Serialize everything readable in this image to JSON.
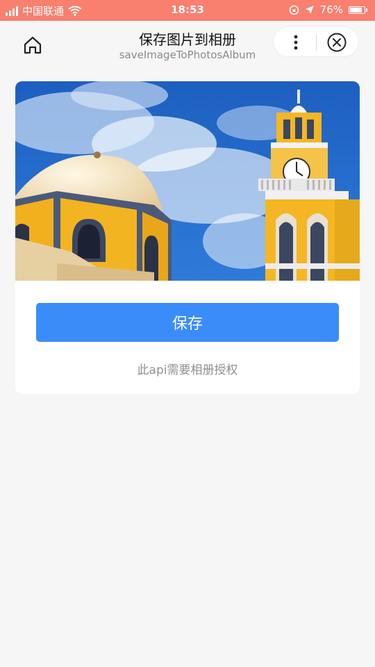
{
  "status_bar": {
    "carrier": "中国联通",
    "time": "18:53",
    "battery": "76%",
    "battery_level": 0.76
  },
  "nav": {
    "title": "保存图片到相册",
    "subtitle": "saveImageToPhotosAlbum",
    "home_icon": "home-icon",
    "more_icon": "more-icon",
    "close_icon": "close-icon"
  },
  "content": {
    "save_button_label": "保存",
    "hint": "此api需要相册授权"
  },
  "colors": {
    "status_bar": "#f97f6f",
    "primary": "#3a8cf9",
    "background": "#f6f6f7"
  }
}
